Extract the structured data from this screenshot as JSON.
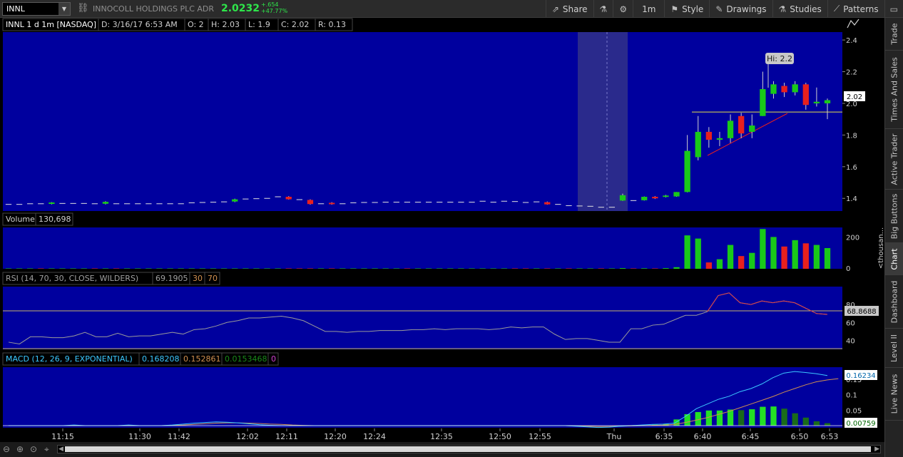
{
  "toolbar": {
    "symbol": "INNL",
    "company": "INNOCOLL HOLDINGS PLC ADR",
    "last": "2.0232",
    "change_abs": "+.654",
    "change_pct": "+47.77%",
    "buttons": [
      {
        "label": "Share",
        "icon": "share-icon"
      },
      {
        "label": "",
        "icon": "flask-icon"
      },
      {
        "label": "",
        "icon": "gear-icon"
      },
      {
        "label": "1m",
        "icon": ""
      },
      {
        "label": "Style",
        "icon": "style-icon"
      },
      {
        "label": "Drawings",
        "icon": "pencil-icon"
      },
      {
        "label": "Studies",
        "icon": "flask-icon"
      },
      {
        "label": "Patterns",
        "icon": "patterns-icon"
      }
    ]
  },
  "price_panel": {
    "header": [
      "INNL 1 d 1m [NASDAQ]",
      "D: 3/16/17 6:53 AM",
      "O: 2",
      "H: 2.03",
      "L: 1.9",
      "C: 2.02",
      "R: 0.13"
    ],
    "hi_label": "Hi: 2.2",
    "current_price_label": "2.02"
  },
  "volume_panel": {
    "header": [
      "Volume",
      "130,698"
    ],
    "unit_label": "<thousan..."
  },
  "rsi_panel": {
    "header": [
      "RSI (14, 70, 30, CLOSE, WILDERS)",
      "69.1905",
      "30",
      "70"
    ],
    "current_label": "68.8688"
  },
  "macd_panel": {
    "header": [
      "MACD (12, 26, 9, EXPONENTIAL)",
      "0.168208",
      "0.152861",
      "0.0153468",
      "0"
    ],
    "value_label": "0.16234",
    "diff_label": "0.00759"
  },
  "time_axis": [
    "11:15",
    "11:30",
    "11:42",
    "12:02",
    "12:11",
    "12:20",
    "12:24",
    "12:35",
    "12:50",
    "12:55",
    "Thu",
    "6:35",
    "6:40",
    "6:45",
    "6:50",
    "6:53"
  ],
  "side_tabs": [
    "Trade",
    "Times And Sales",
    "Active Trader",
    "Big Buttons",
    "Chart",
    "Dashboard",
    "Level II",
    "Live News"
  ],
  "colors": {
    "panel_bg": "#00009e",
    "up": "#19c919",
    "down": "#e8201e",
    "rsi_line": "#9a9a9a",
    "rsi_hot": "#e04040",
    "macd_value": "#3cc8ff",
    "macd_avg": "#d09050",
    "macd_diff_up": "#24e024",
    "macd_diff_down": "#1a6b1a"
  },
  "chart_data": {
    "type": "candlestick",
    "price_axis": {
      "ticks": [
        2.4,
        2.2,
        2.0,
        1.8,
        1.6,
        1.4
      ],
      "range": [
        1.32,
        2.45
      ]
    },
    "candles": [
      {
        "o": 1.362,
        "h": 1.366,
        "l": 1.358,
        "c": 1.362
      },
      {
        "o": 1.362,
        "h": 1.366,
        "l": 1.358,
        "c": 1.362
      },
      {
        "o": 1.362,
        "h": 1.368,
        "l": 1.358,
        "c": 1.366
      },
      {
        "o": 1.372,
        "h": 1.376,
        "l": 1.364,
        "c": 1.366
      },
      {
        "o": 1.366,
        "h": 1.376,
        "l": 1.362,
        "c": 1.374
      },
      {
        "o": 1.368,
        "h": 1.372,
        "l": 1.364,
        "c": 1.368
      },
      {
        "o": 1.368,
        "h": 1.372,
        "l": 1.364,
        "c": 1.368
      },
      {
        "o": 1.368,
        "h": 1.372,
        "l": 1.364,
        "c": 1.368
      },
      {
        "o": 1.368,
        "h": 1.372,
        "l": 1.362,
        "c": 1.366
      },
      {
        "o": 1.366,
        "h": 1.382,
        "l": 1.362,
        "c": 1.378
      },
      {
        "o": 1.372,
        "h": 1.376,
        "l": 1.364,
        "c": 1.366
      },
      {
        "o": 1.366,
        "h": 1.37,
        "l": 1.362,
        "c": 1.366
      },
      {
        "o": 1.366,
        "h": 1.37,
        "l": 1.362,
        "c": 1.366
      },
      {
        "o": 1.366,
        "h": 1.37,
        "l": 1.362,
        "c": 1.366
      },
      {
        "o": 1.366,
        "h": 1.37,
        "l": 1.362,
        "c": 1.366
      },
      {
        "o": 1.366,
        "h": 1.37,
        "l": 1.362,
        "c": 1.366
      },
      {
        "o": 1.366,
        "h": 1.37,
        "l": 1.362,
        "c": 1.366
      },
      {
        "o": 1.37,
        "h": 1.376,
        "l": 1.366,
        "c": 1.372
      },
      {
        "o": 1.372,
        "h": 1.378,
        "l": 1.368,
        "c": 1.374
      },
      {
        "o": 1.374,
        "h": 1.38,
        "l": 1.37,
        "c": 1.376
      },
      {
        "o": 1.376,
        "h": 1.382,
        "l": 1.372,
        "c": 1.378
      },
      {
        "o": 1.38,
        "h": 1.398,
        "l": 1.376,
        "c": 1.394
      },
      {
        "o": 1.394,
        "h": 1.4,
        "l": 1.39,
        "c": 1.396
      },
      {
        "o": 1.396,
        "h": 1.402,
        "l": 1.392,
        "c": 1.398
      },
      {
        "o": 1.398,
        "h": 1.404,
        "l": 1.394,
        "c": 1.4
      },
      {
        "o": 1.406,
        "h": 1.414,
        "l": 1.402,
        "c": 1.41
      },
      {
        "o": 1.41,
        "h": 1.414,
        "l": 1.392,
        "c": 1.394
      },
      {
        "o": 1.394,
        "h": 1.398,
        "l": 1.388,
        "c": 1.392
      },
      {
        "o": 1.39,
        "h": 1.394,
        "l": 1.36,
        "c": 1.364
      },
      {
        "o": 1.364,
        "h": 1.372,
        "l": 1.36,
        "c": 1.366
      },
      {
        "o": 1.372,
        "h": 1.376,
        "l": 1.36,
        "c": 1.364
      },
      {
        "o": 1.366,
        "h": 1.372,
        "l": 1.36,
        "c": 1.366
      },
      {
        "o": 1.37,
        "h": 1.376,
        "l": 1.366,
        "c": 1.372
      },
      {
        "o": 1.374,
        "h": 1.378,
        "l": 1.37,
        "c": 1.374
      },
      {
        "o": 1.374,
        "h": 1.378,
        "l": 1.37,
        "c": 1.374
      },
      {
        "o": 1.376,
        "h": 1.38,
        "l": 1.372,
        "c": 1.376
      },
      {
        "o": 1.376,
        "h": 1.38,
        "l": 1.372,
        "c": 1.376
      },
      {
        "o": 1.38,
        "h": 1.384,
        "l": 1.372,
        "c": 1.376
      },
      {
        "o": 1.376,
        "h": 1.38,
        "l": 1.372,
        "c": 1.376
      },
      {
        "o": 1.376,
        "h": 1.38,
        "l": 1.372,
        "c": 1.376
      },
      {
        "o": 1.376,
        "h": 1.38,
        "l": 1.372,
        "c": 1.376
      },
      {
        "o": 1.376,
        "h": 1.38,
        "l": 1.372,
        "c": 1.376
      },
      {
        "o": 1.376,
        "h": 1.38,
        "l": 1.372,
        "c": 1.376
      },
      {
        "o": 1.376,
        "h": 1.38,
        "l": 1.372,
        "c": 1.376
      },
      {
        "o": 1.376,
        "h": 1.384,
        "l": 1.372,
        "c": 1.382
      },
      {
        "o": 1.376,
        "h": 1.38,
        "l": 1.372,
        "c": 1.376
      },
      {
        "o": 1.376,
        "h": 1.384,
        "l": 1.372,
        "c": 1.382
      },
      {
        "o": 1.382,
        "h": 1.386,
        "l": 1.376,
        "c": 1.38
      },
      {
        "o": 1.38,
        "h": 1.384,
        "l": 1.372,
        "c": 1.374
      },
      {
        "o": 1.374,
        "h": 1.378,
        "l": 1.37,
        "c": 1.378
      },
      {
        "o": 1.376,
        "h": 1.38,
        "l": 1.36,
        "c": 1.362
      },
      {
        "o": 1.362,
        "h": 1.368,
        "l": 1.356,
        "c": 1.362
      },
      {
        "o": 1.36,
        "h": 1.364,
        "l": 1.348,
        "c": 1.354
      },
      {
        "o": 1.352,
        "h": 1.356,
        "l": 1.346,
        "c": 1.352
      },
      {
        "o": 1.35,
        "h": 1.356,
        "l": 1.344,
        "c": 1.35
      },
      {
        "o": 1.35,
        "h": 1.354,
        "l": 1.34,
        "c": 1.344
      },
      {
        "o": 1.344,
        "h": 1.35,
        "l": 1.338,
        "c": 1.344
      },
      {
        "o": 1.386,
        "h": 1.43,
        "l": 1.384,
        "c": 1.42
      },
      {
        "o": 1.388,
        "h": 1.396,
        "l": 1.38,
        "c": 1.386
      },
      {
        "o": 1.388,
        "h": 1.412,
        "l": 1.386,
        "c": 1.41
      },
      {
        "o": 1.41,
        "h": 1.414,
        "l": 1.396,
        "c": 1.4
      },
      {
        "o": 1.41,
        "h": 1.422,
        "l": 1.406,
        "c": 1.418
      },
      {
        "o": 1.412,
        "h": 1.44,
        "l": 1.41,
        "c": 1.44
      },
      {
        "o": 1.44,
        "h": 1.8,
        "l": 1.438,
        "c": 1.7
      },
      {
        "o": 1.66,
        "h": 1.92,
        "l": 1.64,
        "c": 1.82
      },
      {
        "o": 1.82,
        "h": 1.85,
        "l": 1.72,
        "c": 1.77
      },
      {
        "o": 1.77,
        "h": 1.82,
        "l": 1.73,
        "c": 1.78
      },
      {
        "o": 1.78,
        "h": 1.93,
        "l": 1.75,
        "c": 1.89
      },
      {
        "o": 1.92,
        "h": 1.94,
        "l": 1.78,
        "c": 1.81
      },
      {
        "o": 1.82,
        "h": 1.93,
        "l": 1.78,
        "c": 1.86
      },
      {
        "o": 1.92,
        "h": 2.2,
        "l": 1.92,
        "c": 2.09
      },
      {
        "o": 2.06,
        "h": 2.14,
        "l": 2.03,
        "c": 2.12
      },
      {
        "o": 2.11,
        "h": 2.13,
        "l": 2.04,
        "c": 2.07
      },
      {
        "o": 2.07,
        "h": 2.14,
        "l": 2.05,
        "c": 2.12
      },
      {
        "o": 2.12,
        "h": 2.13,
        "l": 1.96,
        "c": 1.99
      },
      {
        "o": 2.0,
        "h": 2.1,
        "l": 1.98,
        "c": 2.01
      },
      {
        "o": 2.0,
        "h": 2.03,
        "l": 1.9,
        "c": 2.02
      }
    ],
    "horizontal_line": 1.945,
    "volume_axis_ticks": [
      200,
      0
    ],
    "volume": [
      1,
      1,
      1,
      1,
      1,
      1,
      1,
      1,
      1,
      2,
      1,
      1,
      1,
      1,
      1,
      1,
      1,
      1,
      1,
      1,
      1,
      1,
      1,
      1,
      1,
      1,
      1,
      1,
      1,
      1,
      1,
      1,
      1,
      1,
      1,
      1,
      1,
      1,
      1,
      1,
      1,
      1,
      1,
      1,
      1,
      1,
      1,
      1,
      1,
      1,
      1,
      1,
      1,
      1,
      1,
      1,
      1,
      4,
      2,
      3,
      2,
      4,
      10,
      210,
      190,
      40,
      60,
      150,
      80,
      100,
      250,
      200,
      140,
      180,
      160,
      150,
      130
    ],
    "rsi_axis_ticks": [
      80,
      60,
      40
    ],
    "rsi": [
      38,
      36,
      44,
      44,
      43,
      43,
      45,
      49,
      44,
      44,
      48,
      44,
      45,
      45,
      47,
      49,
      47,
      52,
      53,
      56,
      60,
      62,
      65,
      65,
      66,
      67,
      65,
      62,
      56,
      50,
      50,
      49,
      50,
      50,
      51,
      51,
      51,
      52,
      52,
      53,
      52,
      53,
      53,
      53,
      52,
      53,
      55,
      54,
      55,
      55,
      47,
      41,
      42,
      42,
      40,
      38,
      38,
      53,
      53,
      57,
      58,
      63,
      68,
      68,
      72,
      90,
      93,
      82,
      80,
      84,
      82,
      84,
      82,
      76,
      70,
      69
    ],
    "macd_axis_ticks": [
      0.15,
      0.1,
      0.05
    ],
    "macd_value": [
      0.0,
      0.0,
      0.0,
      0.0,
      0.0,
      0.0,
      0.002,
      0.0,
      0.0,
      0.0,
      0.0,
      0.002,
      0.0,
      0.0,
      0.0,
      0.002,
      0.005,
      0.008,
      0.01,
      0.012,
      0.011,
      0.009,
      0.006,
      0.003,
      0.001,
      0.0,
      0.0,
      0.0,
      0.0,
      0.0,
      0.0,
      0.0,
      0.0,
      0.0,
      0.0,
      0.0,
      0.0,
      0.0,
      0.0,
      0.0,
      0.0,
      0.0,
      0.0,
      0.0,
      0.0,
      0.0,
      0.0,
      0.0,
      0.0,
      0.0,
      0.0,
      0.0,
      -0.002,
      -0.004,
      -0.006,
      -0.005,
      -0.002,
      0.0,
      0.002,
      0.004,
      0.005,
      0.008,
      0.03,
      0.055,
      0.07,
      0.085,
      0.095,
      0.11,
      0.12,
      0.135,
      0.155,
      0.17,
      0.175,
      0.172,
      0.168,
      0.162
    ],
    "macd_avg": [
      0.0,
      0.0,
      0.0,
      0.0,
      0.0,
      0.0,
      0.0,
      0.0,
      0.0,
      0.0,
      0.0,
      0.0,
      0.0,
      0.0,
      0.0,
      0.001,
      0.002,
      0.004,
      0.006,
      0.008,
      0.009,
      0.009,
      0.008,
      0.007,
      0.005,
      0.004,
      0.002,
      0.001,
      0.0,
      0.0,
      0.0,
      0.0,
      0.0,
      0.0,
      0.0,
      0.0,
      0.0,
      0.0,
      0.0,
      0.0,
      0.0,
      0.0,
      0.0,
      0.0,
      0.0,
      0.0,
      0.0,
      0.0,
      0.0,
      0.0,
      0.0,
      0.0,
      -0.001,
      -0.002,
      -0.003,
      -0.003,
      -0.002,
      -0.001,
      0.0,
      0.001,
      0.002,
      0.004,
      0.01,
      0.018,
      0.026,
      0.036,
      0.046,
      0.058,
      0.07,
      0.082,
      0.094,
      0.108,
      0.12,
      0.132,
      0.142,
      0.148,
      0.152
    ],
    "macd_diff": [
      0,
      0,
      0,
      0,
      0,
      0,
      0,
      0,
      0,
      0,
      0,
      0,
      0,
      0,
      0,
      0,
      0,
      0,
      0,
      0,
      0,
      0,
      0,
      0,
      0,
      0,
      0,
      0,
      0,
      0,
      0,
      0,
      0,
      0,
      0,
      0,
      0,
      0,
      0,
      0,
      0,
      0,
      0,
      0,
      0,
      0,
      0,
      0,
      0,
      0,
      0,
      0,
      0,
      0,
      0,
      0,
      0,
      0,
      0,
      0,
      0.003,
      0.006,
      0.02,
      0.037,
      0.044,
      0.049,
      0.049,
      0.052,
      0.05,
      0.053,
      0.061,
      0.062,
      0.055,
      0.04,
      0.026,
      0.014,
      0.008
    ]
  }
}
